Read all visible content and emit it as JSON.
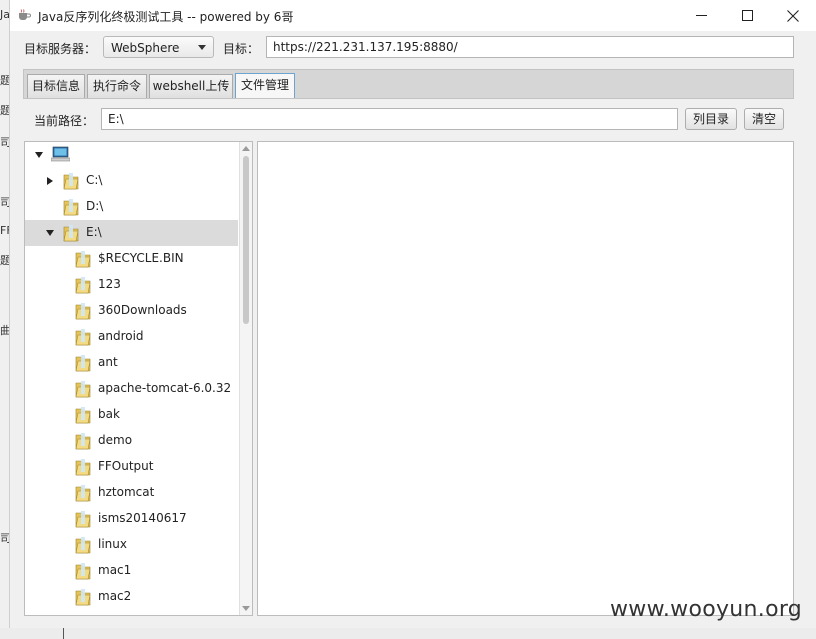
{
  "window": {
    "title": "Java反序列化终极测试工具  -- powered by 6哥",
    "controls": [
      "minimize",
      "maximize",
      "close"
    ]
  },
  "target_bar": {
    "server_label": "目标服务器：",
    "server_value": "WebSphere",
    "target_label": "目标：",
    "target_value": "https://221.231.137.195:8880/"
  },
  "tabs": [
    {
      "label": "目标信息",
      "active": false
    },
    {
      "label": "执行命令",
      "active": false
    },
    {
      "label": "webshell上传",
      "active": false
    },
    {
      "label": "文件管理",
      "active": true
    }
  ],
  "path_bar": {
    "label": "当前路径：",
    "value": "E:\\",
    "list_button": "列目录",
    "clear_button": "清空"
  },
  "tree": {
    "root_icon": "computer-icon",
    "drives": [
      {
        "label": "C:\\",
        "expanded": false,
        "has_children": true
      },
      {
        "label": "D:\\",
        "expanded": false,
        "has_children": false
      },
      {
        "label": "E:\\",
        "expanded": true,
        "selected": true,
        "has_children": true
      }
    ],
    "e_children": [
      "$RECYCLE.BIN",
      "123",
      "360Downloads",
      "android",
      "ant",
      "apache-tomcat-6.0.32",
      "bak",
      "demo",
      "FFOutput",
      "hztomcat",
      "isms20140617",
      "linux",
      "mac1",
      "mac2"
    ]
  },
  "background_fragments": [
    "Ja",
    "题",
    "题",
    "司",
    "司",
    "FF",
    "题",
    "曲",
    "司"
  ],
  "watermark": "www.wooyun.org",
  "colors": {
    "window_bg": "#f0f0f0",
    "active_tab_border": "#6da4cf",
    "selected_row": "#dbdbdb"
  }
}
